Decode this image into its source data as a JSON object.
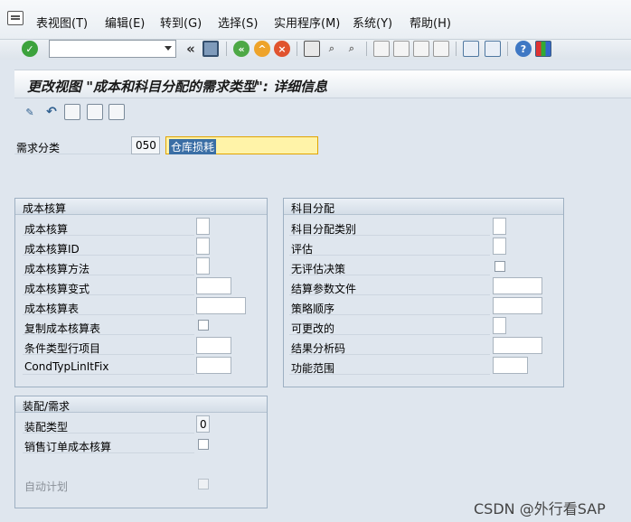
{
  "menu": {
    "items": [
      "表视图(T)",
      "编辑(E)",
      "转到(G)",
      "选择(S)",
      "实用程序(M)",
      "系统(Y)",
      "帮助(H)"
    ]
  },
  "toolbar": {
    "command_field_value": "",
    "icons": [
      "enter-check-icon",
      "command-field",
      "collapse-icon",
      "save-icon",
      "back-icon",
      "exit-icon",
      "cancel-icon",
      "print-icon",
      "find-icon",
      "find-next-icon",
      "first-page-icon",
      "previous-page-icon",
      "next-page-icon",
      "last-page-icon",
      "new-session-icon",
      "shortcut-icon",
      "help-icon",
      "customize-layout-icon"
    ]
  },
  "title": "更改视图 \"成本和科目分配的需求类型\": 详细信息",
  "app_toolbar": {
    "icons": [
      "display-change-icon",
      "undo-icon",
      "previous-entry-icon",
      "next-entry-icon",
      "select-entry-icon"
    ]
  },
  "header_field": {
    "label": "需求分类",
    "code": "050",
    "value": "仓库损耗"
  },
  "cost_group": {
    "title": "成本核算",
    "fields": [
      {
        "label": "成本核算",
        "type": "small"
      },
      {
        "label": "成本核算ID",
        "type": "small"
      },
      {
        "label": "成本核算方法",
        "type": "small"
      },
      {
        "label": "成本核算变式",
        "type": "medium"
      },
      {
        "label": "成本核算表",
        "type": "wide"
      },
      {
        "label": "复制成本核算表",
        "type": "checkbox"
      },
      {
        "label": "条件类型行项目",
        "type": "medium"
      },
      {
        "label": "CondTypLinItFix",
        "type": "medium"
      }
    ]
  },
  "account_group": {
    "title": "科目分配",
    "fields": [
      {
        "label": "科目分配类别",
        "type": "small"
      },
      {
        "label": "评估",
        "type": "small"
      },
      {
        "label": "无评估决策",
        "type": "checkbox"
      },
      {
        "label": "结算参数文件",
        "type": "wide"
      },
      {
        "label": "策略顺序",
        "type": "wide"
      },
      {
        "label": "可更改的",
        "type": "small"
      },
      {
        "label": "结果分析码",
        "type": "wide"
      },
      {
        "label": "功能范围",
        "type": "medium"
      }
    ]
  },
  "assembly_group": {
    "title": "装配/需求",
    "fields": [
      {
        "label": "装配类型",
        "value": "0"
      },
      {
        "label": "销售订单成本核算"
      },
      {
        "label": "自动计划"
      }
    ]
  },
  "watermark": "CSDN @外行看SAP",
  "colors": {
    "highlight_field": "#fff3a8",
    "highlight_border": "#e2a400",
    "selection": "#3a6ea5"
  }
}
